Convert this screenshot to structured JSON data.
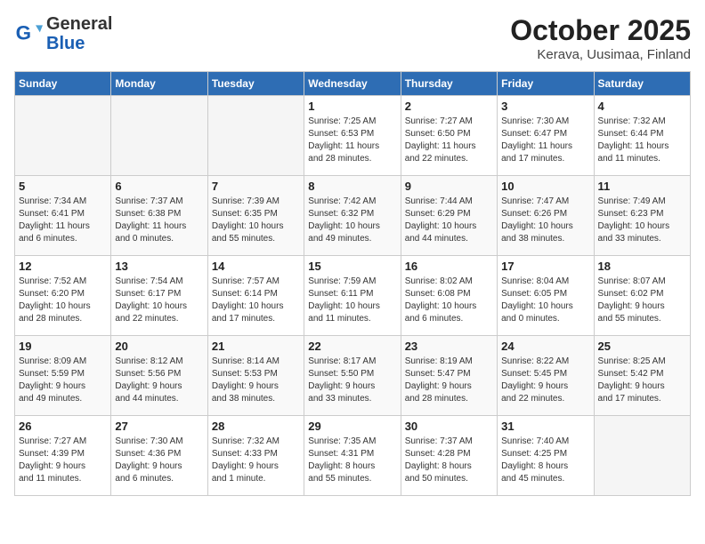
{
  "header": {
    "logo_general": "General",
    "logo_blue": "Blue",
    "month": "October 2025",
    "location": "Kerava, Uusimaa, Finland"
  },
  "weekdays": [
    "Sunday",
    "Monday",
    "Tuesday",
    "Wednesday",
    "Thursday",
    "Friday",
    "Saturday"
  ],
  "weeks": [
    [
      {
        "day": "",
        "info": ""
      },
      {
        "day": "",
        "info": ""
      },
      {
        "day": "",
        "info": ""
      },
      {
        "day": "1",
        "info": "Sunrise: 7:25 AM\nSunset: 6:53 PM\nDaylight: 11 hours\nand 28 minutes."
      },
      {
        "day": "2",
        "info": "Sunrise: 7:27 AM\nSunset: 6:50 PM\nDaylight: 11 hours\nand 22 minutes."
      },
      {
        "day": "3",
        "info": "Sunrise: 7:30 AM\nSunset: 6:47 PM\nDaylight: 11 hours\nand 17 minutes."
      },
      {
        "day": "4",
        "info": "Sunrise: 7:32 AM\nSunset: 6:44 PM\nDaylight: 11 hours\nand 11 minutes."
      }
    ],
    [
      {
        "day": "5",
        "info": "Sunrise: 7:34 AM\nSunset: 6:41 PM\nDaylight: 11 hours\nand 6 minutes."
      },
      {
        "day": "6",
        "info": "Sunrise: 7:37 AM\nSunset: 6:38 PM\nDaylight: 11 hours\nand 0 minutes."
      },
      {
        "day": "7",
        "info": "Sunrise: 7:39 AM\nSunset: 6:35 PM\nDaylight: 10 hours\nand 55 minutes."
      },
      {
        "day": "8",
        "info": "Sunrise: 7:42 AM\nSunset: 6:32 PM\nDaylight: 10 hours\nand 49 minutes."
      },
      {
        "day": "9",
        "info": "Sunrise: 7:44 AM\nSunset: 6:29 PM\nDaylight: 10 hours\nand 44 minutes."
      },
      {
        "day": "10",
        "info": "Sunrise: 7:47 AM\nSunset: 6:26 PM\nDaylight: 10 hours\nand 38 minutes."
      },
      {
        "day": "11",
        "info": "Sunrise: 7:49 AM\nSunset: 6:23 PM\nDaylight: 10 hours\nand 33 minutes."
      }
    ],
    [
      {
        "day": "12",
        "info": "Sunrise: 7:52 AM\nSunset: 6:20 PM\nDaylight: 10 hours\nand 28 minutes."
      },
      {
        "day": "13",
        "info": "Sunrise: 7:54 AM\nSunset: 6:17 PM\nDaylight: 10 hours\nand 22 minutes."
      },
      {
        "day": "14",
        "info": "Sunrise: 7:57 AM\nSunset: 6:14 PM\nDaylight: 10 hours\nand 17 minutes."
      },
      {
        "day": "15",
        "info": "Sunrise: 7:59 AM\nSunset: 6:11 PM\nDaylight: 10 hours\nand 11 minutes."
      },
      {
        "day": "16",
        "info": "Sunrise: 8:02 AM\nSunset: 6:08 PM\nDaylight: 10 hours\nand 6 minutes."
      },
      {
        "day": "17",
        "info": "Sunrise: 8:04 AM\nSunset: 6:05 PM\nDaylight: 10 hours\nand 0 minutes."
      },
      {
        "day": "18",
        "info": "Sunrise: 8:07 AM\nSunset: 6:02 PM\nDaylight: 9 hours\nand 55 minutes."
      }
    ],
    [
      {
        "day": "19",
        "info": "Sunrise: 8:09 AM\nSunset: 5:59 PM\nDaylight: 9 hours\nand 49 minutes."
      },
      {
        "day": "20",
        "info": "Sunrise: 8:12 AM\nSunset: 5:56 PM\nDaylight: 9 hours\nand 44 minutes."
      },
      {
        "day": "21",
        "info": "Sunrise: 8:14 AM\nSunset: 5:53 PM\nDaylight: 9 hours\nand 38 minutes."
      },
      {
        "day": "22",
        "info": "Sunrise: 8:17 AM\nSunset: 5:50 PM\nDaylight: 9 hours\nand 33 minutes."
      },
      {
        "day": "23",
        "info": "Sunrise: 8:19 AM\nSunset: 5:47 PM\nDaylight: 9 hours\nand 28 minutes."
      },
      {
        "day": "24",
        "info": "Sunrise: 8:22 AM\nSunset: 5:45 PM\nDaylight: 9 hours\nand 22 minutes."
      },
      {
        "day": "25",
        "info": "Sunrise: 8:25 AM\nSunset: 5:42 PM\nDaylight: 9 hours\nand 17 minutes."
      }
    ],
    [
      {
        "day": "26",
        "info": "Sunrise: 7:27 AM\nSunset: 4:39 PM\nDaylight: 9 hours\nand 11 minutes."
      },
      {
        "day": "27",
        "info": "Sunrise: 7:30 AM\nSunset: 4:36 PM\nDaylight: 9 hours\nand 6 minutes."
      },
      {
        "day": "28",
        "info": "Sunrise: 7:32 AM\nSunset: 4:33 PM\nDaylight: 9 hours\nand 1 minute."
      },
      {
        "day": "29",
        "info": "Sunrise: 7:35 AM\nSunset: 4:31 PM\nDaylight: 8 hours\nand 55 minutes."
      },
      {
        "day": "30",
        "info": "Sunrise: 7:37 AM\nSunset: 4:28 PM\nDaylight: 8 hours\nand 50 minutes."
      },
      {
        "day": "31",
        "info": "Sunrise: 7:40 AM\nSunset: 4:25 PM\nDaylight: 8 hours\nand 45 minutes."
      },
      {
        "day": "",
        "info": ""
      }
    ]
  ]
}
